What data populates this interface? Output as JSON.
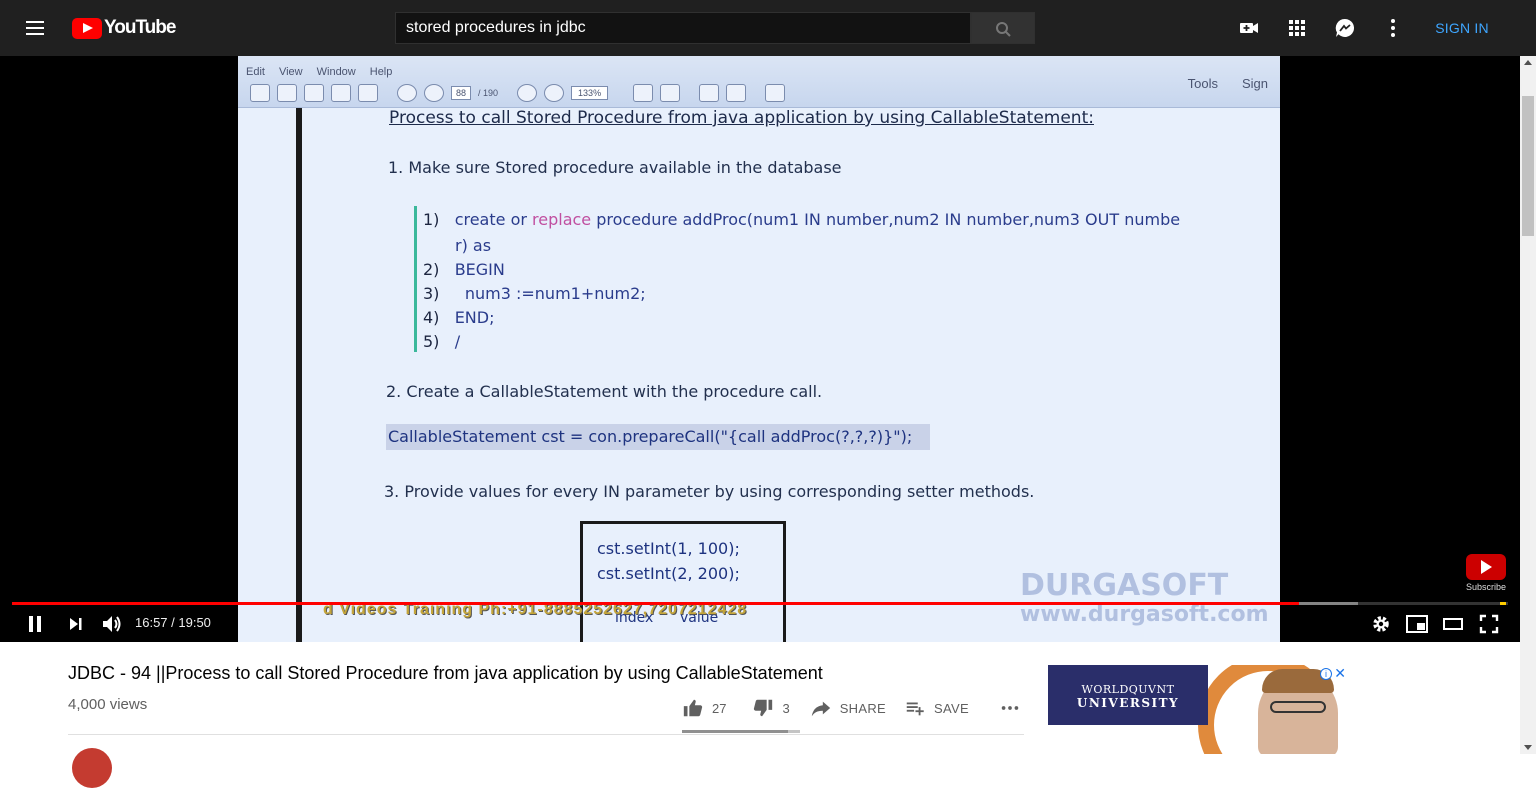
{
  "header": {
    "logo_text": "YouTube",
    "search_query": "stored procedures in jdbc",
    "sign_in_label": "SIGN IN"
  },
  "video": {
    "pdf_menu": [
      "Edit",
      "View",
      "Window",
      "Help"
    ],
    "pdf_page": "88",
    "pdf_total": "/ 190",
    "pdf_zoom": "133%",
    "pdf_right": [
      "Tools",
      "Sign"
    ],
    "slide": {
      "title": "Process to call Stored Procedure from java application by using CallableStatement:",
      "step1": "1. Make sure Stored procedure available in the database",
      "code_lines": [
        {
          "n": "1)",
          "pre": "create or ",
          "kw": "replace",
          "post": " procedure addProc(num1 IN number,num2 IN number,num3 OUT numbe"
        },
        {
          "n": "",
          "pre": "r) as",
          "kw": "",
          "post": ""
        },
        {
          "n": "2)",
          "pre": "BEGIN",
          "kw": "",
          "post": ""
        },
        {
          "n": "3)",
          "pre": "  num3 :=num1+num2;",
          "kw": "",
          "post": ""
        },
        {
          "n": "4)",
          "pre": "END;",
          "kw": "",
          "post": ""
        },
        {
          "n": "5)",
          "pre": "/",
          "kw": "",
          "post": ""
        }
      ],
      "step2": "2. Create a CallableStatement with the procedure call.",
      "callable": "CallableStatement cst = con.prepareCall(\"{call addProc(?,?,?)}\");",
      "step3": "3. Provide values for every IN parameter by using corresponding setter methods.",
      "set1": "cst.setInt(1, 100);",
      "set2": "cst.setInt(2, 200);",
      "box_labels": "index      value"
    },
    "watermark_1": "DURGASOFT",
    "watermark_2": "www.durgasoft.com",
    "ticker": "d Videos Training Ph:+91-8885252627,7207212428",
    "subscribe_label": "Subscribe",
    "progress_played": 0.8605,
    "progress_loaded": 0.9,
    "time_current": "16:57",
    "time_total": "19:50",
    "time_display": "16:57 / 19:50"
  },
  "info": {
    "title": "JDBC - 94 ||Process to call Stored Procedure from java application by using CallableStatement",
    "views": "4,000 views",
    "likes": "27",
    "dislikes": "3",
    "share_label": "SHARE",
    "save_label": "SAVE",
    "like_ratio": 0.9
  },
  "ad": {
    "line1": "WORLDQUVNT",
    "line2": "UNIVERSITY",
    "info_icon": "i",
    "close_icon": "✕"
  },
  "colors": {
    "accent": "#ff0000",
    "link": "#3ea6ff",
    "topbar": "#202020"
  }
}
